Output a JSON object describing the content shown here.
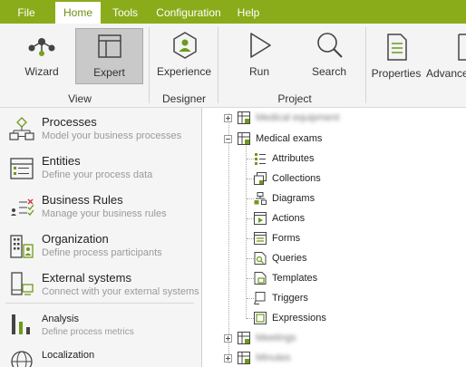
{
  "menu": {
    "items": [
      "File",
      "Home",
      "Tools",
      "Configuration",
      "Help"
    ],
    "active": "Home"
  },
  "ribbon": {
    "groups": {
      "view": "View",
      "designer": "Designer",
      "project": "Project"
    },
    "buttons": {
      "wizard": "Wizard",
      "expert": "Expert",
      "experience": "Experience",
      "run": "Run",
      "search": "Search",
      "properties": "Properties",
      "advanced": "Advance"
    }
  },
  "nav": {
    "items": [
      {
        "title": "Processes",
        "subtitle": "Model your business processes"
      },
      {
        "title": "Entities",
        "subtitle": "Define your process data"
      },
      {
        "title": "Business Rules",
        "subtitle": "Manage your business rules"
      },
      {
        "title": "Organization",
        "subtitle": "Define process participants"
      },
      {
        "title": "External systems",
        "subtitle": "Connect with your external systems"
      },
      {
        "title": "Analysis",
        "subtitle": "Define process metrics"
      },
      {
        "title": "Localization",
        "subtitle": ""
      }
    ]
  },
  "tree": {
    "top_blurred": "Medical equipment",
    "expanded": "Medical exams",
    "children": [
      "Attributes",
      "Collections",
      "Diagrams",
      "Actions",
      "Forms",
      "Queries",
      "Templates",
      "Triggers",
      "Expressions"
    ],
    "bottom_blurred_1": "Meetings",
    "bottom_blurred_2": "Minutes"
  },
  "colors": {
    "accent": "#8aac1a",
    "menu_text": "#ffffff",
    "nav_subtitle": "#9a9a9a",
    "icon_green": "#6f9a1a"
  }
}
